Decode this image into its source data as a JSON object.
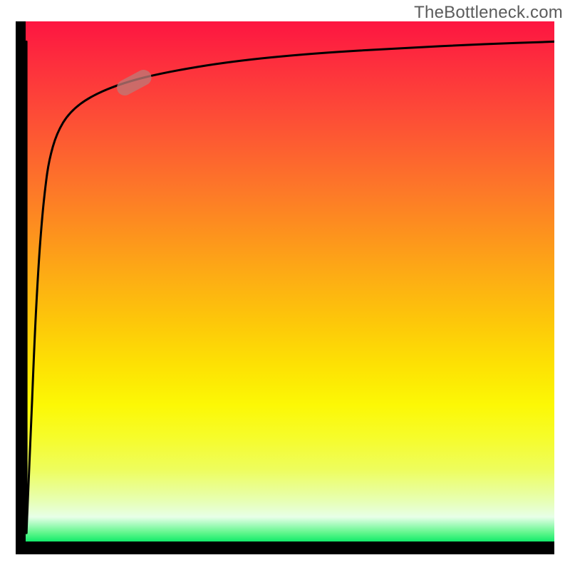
{
  "watermark": "TheBottleneck.com",
  "chart_data": {
    "type": "line",
    "title": "",
    "xlabel": "",
    "ylabel": "",
    "xlim": [
      0,
      100
    ],
    "ylim": [
      0,
      100
    ],
    "grid": false,
    "series": [
      {
        "name": "bottleneck-curve",
        "x": [
          2.0,
          2.7,
          3.4,
          4.1,
          4.8,
          5.5,
          6.2,
          7.6,
          10,
          14,
          20,
          28,
          40,
          55,
          72,
          86,
          100
        ],
        "y": [
          4.0,
          20,
          38,
          52,
          62,
          69,
          74,
          79,
          83,
          86,
          88.5,
          90.5,
          92.5,
          94,
          95,
          95.7,
          96.2
        ]
      },
      {
        "name": "bottleneck-drop",
        "x": [
          2.0,
          2.0
        ],
        "y": [
          96.2,
          4.0
        ]
      }
    ],
    "marker": {
      "name": "highlight-segment",
      "x": 22,
      "y": 88.5,
      "angle_deg": -28
    },
    "background_gradient_stops": [
      {
        "pos": 0.0,
        "color": "#fd1541"
      },
      {
        "pos": 0.5,
        "color": "#fdb010"
      },
      {
        "pos": 0.78,
        "color": "#f6fc2a"
      },
      {
        "pos": 0.93,
        "color": "#e7ffe8"
      },
      {
        "pos": 1.0,
        "color": "#00d862"
      }
    ]
  }
}
